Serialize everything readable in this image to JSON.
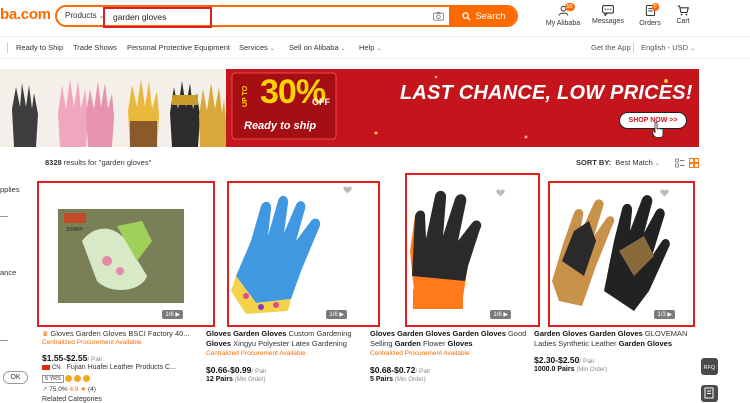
{
  "header": {
    "logo": "ba.com",
    "search": {
      "category": "Products",
      "query": "garden gloves",
      "button": "Search"
    },
    "items": [
      {
        "label": "My Alibaba",
        "badge": ""
      },
      {
        "label": "Messages",
        "badge": ""
      },
      {
        "label": "Orders",
        "badge": "0"
      },
      {
        "label": "Cart",
        "badge": ""
      }
    ]
  },
  "nav": {
    "items": [
      "Ready to Ship",
      "Trade Shows",
      "Personal Protective Equipment",
      "Services",
      "Sell on Alibaba",
      "Help"
    ],
    "right": [
      "Get the App",
      "English - USD"
    ]
  },
  "banner": {
    "upto": "UP TO",
    "percent": "30%",
    "off": "OFF",
    "ready": "Ready to ship",
    "headline": "LAST CHANCE, LOW PRICES!",
    "cta": "SHOP NOW >>"
  },
  "side": {
    "fragment1": "pplies",
    "fragment2": "ance",
    "ok": "OK"
  },
  "results": {
    "count": "8328",
    "text": "results for \"garden gloves\""
  },
  "sort": {
    "label": "SORT BY:",
    "value": "Best Match"
  },
  "products": [
    {
      "counter": "1/6",
      "title_kw": "Gloves Garden Gloves",
      "title_rest": " BSCI Factory 40...",
      "tag": "Centralized Procurement Available",
      "price": "$1.55-$2.55",
      "unit": "/ Pair",
      "country": "CN",
      "supplier": "Fujian Huafei Leather Products C...",
      "years": "5 YRS",
      "rating_pct": "75.0%",
      "rating": "4.9",
      "reviews": "(4)",
      "related": "Related Categories"
    },
    {
      "counter": "1/6",
      "title_kw": "Gloves Garden Gloves",
      "title_rest": " Custom Gardening",
      "title_line2_kw": "Gloves",
      "title_line2_rest": " Xingyu Polyester Latex Gardening",
      "tag": "Centralized Procurement Available",
      "price": "$0.66-$0.99",
      "unit": "/ Pair",
      "moq": "12 Pairs",
      "moq_sub": "(Min Order)"
    },
    {
      "counter": "1/6",
      "title_kw": "Gloves Garden Gloves Garden Gloves",
      "title_rest": " Good",
      "title_line2_rest1": "Selling ",
      "title_line2_kw1": "Garden",
      "title_line2_rest2": " Flower ",
      "title_line2_kw2": "Gloves",
      "tag": "Centralized Procurement Available",
      "price": "$0.68-$0.72",
      "unit": "/ Pair",
      "moq": "5 Pairs",
      "moq_sub": "(Min Order)"
    },
    {
      "counter": "1/3",
      "title_kw": "Garden Gloves Garden Gloves",
      "title_rest": " GLOVEMAN",
      "title_line2_rest": "Ladies Synthetic Leather ",
      "title_line2_kw": "Garden Gloves",
      "price": "$2.30-$2.50",
      "unit": "/ Pair",
      "moq": "1000.0 Pairs",
      "moq_sub": "(Min Order)"
    }
  ],
  "colors": {
    "brand": "#ff6a00",
    "banner_red": "#c4151c",
    "highlight": "#e02020"
  }
}
